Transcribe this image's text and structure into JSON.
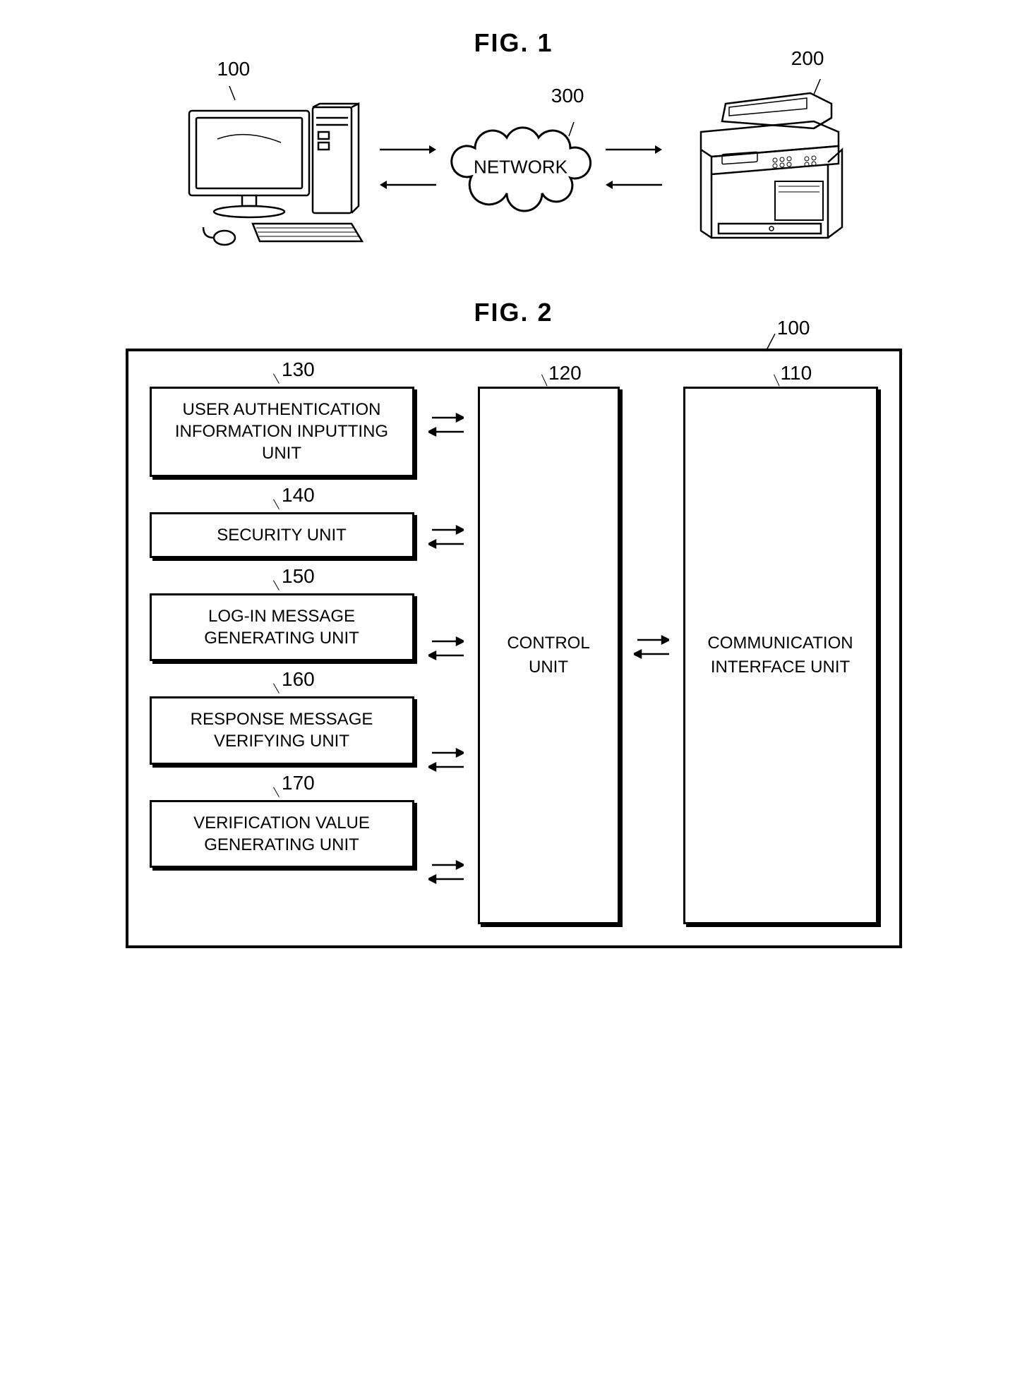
{
  "fig1": {
    "title": "FIG. 1",
    "computer_ref": "100",
    "network_ref": "300",
    "network_label": "NETWORK",
    "printer_ref": "200"
  },
  "fig2": {
    "title": "FIG. 2",
    "outer_ref": "100",
    "control_ref": "120",
    "control_label": "CONTROL UNIT",
    "comm_ref": "110",
    "comm_label": "COMMUNICATION INTERFACE UNIT",
    "units": [
      {
        "ref": "130",
        "label": "USER AUTHENTICATION INFORMATION INPUTTING UNIT"
      },
      {
        "ref": "140",
        "label": "SECURITY UNIT"
      },
      {
        "ref": "150",
        "label": "LOG-IN MESSAGE GENERATING UNIT"
      },
      {
        "ref": "160",
        "label": "RESPONSE MESSAGE VERIFYING UNIT"
      },
      {
        "ref": "170",
        "label": "VERIFICATION VALUE GENERATING UNIT"
      }
    ]
  }
}
